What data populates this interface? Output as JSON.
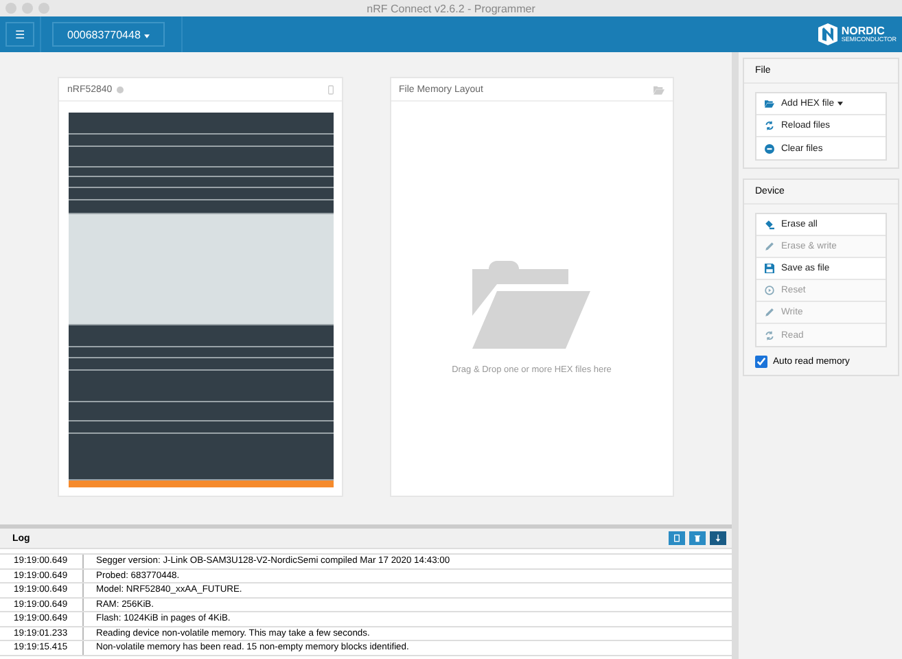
{
  "window": {
    "title": "nRF Connect v2.6.2 - Programmer"
  },
  "header": {
    "menu_glyph": "☰",
    "device": "000683770448",
    "logo": "NORDIC",
    "logo_sub": "SEMICONDUCTOR"
  },
  "device_card": {
    "title": "nRF52840"
  },
  "file_card": {
    "title": "File Memory Layout",
    "hint": "Drag & Drop one or more HEX files here"
  },
  "file_panel": {
    "title": "File",
    "buttons": [
      {
        "kind": "add",
        "label": "Add HEX file",
        "dropdown": true
      },
      {
        "kind": "reload",
        "label": "Reload files",
        "dropdown": false
      },
      {
        "kind": "clear",
        "label": "Clear files",
        "dropdown": false
      }
    ]
  },
  "device_panel": {
    "title": "Device",
    "buttons": [
      {
        "kind": "erase",
        "label": "Erase all",
        "disabled": false
      },
      {
        "kind": "pencil",
        "label": "Erase & write",
        "disabled": true
      },
      {
        "kind": "save",
        "label": "Save as file",
        "disabled": false
      },
      {
        "kind": "reset",
        "label": "Reset",
        "disabled": true
      },
      {
        "kind": "pencil",
        "label": "Write",
        "disabled": true
      },
      {
        "kind": "reload",
        "label": "Read",
        "disabled": true
      }
    ],
    "auto_read": {
      "label": "Auto read memory",
      "checked": true
    }
  },
  "log": {
    "title": "Log",
    "rows": [
      {
        "time": "19:19:00.649",
        "message": "Segger version: J-Link OB-SAM3U128-V2-NordicSemi compiled Mar 17 2020 14:43:00"
      },
      {
        "time": "19:19:00.649",
        "message": "Probed: 683770448."
      },
      {
        "time": "19:19:00.649",
        "message": "Model: NRF52840_xxAA_FUTURE."
      },
      {
        "time": "19:19:00.649",
        "message": "RAM: 256KiB."
      },
      {
        "time": "19:19:00.649",
        "message": "Flash: 1024KiB in pages of 4KiB."
      },
      {
        "time": "19:19:01.233",
        "message": "Reading device non-volatile memory. This may take a few seconds."
      },
      {
        "time": "19:19:15.415",
        "message": "Non-volatile memory has been read. 15 non-empty memory blocks identified."
      }
    ]
  }
}
